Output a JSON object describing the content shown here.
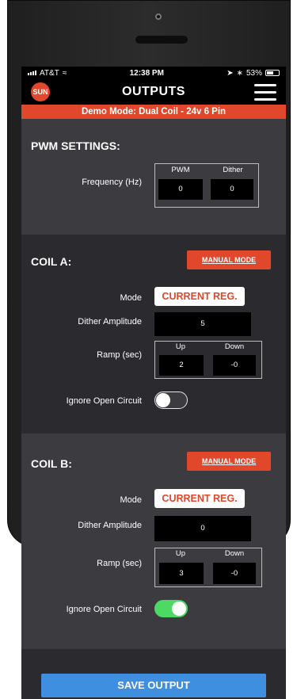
{
  "status_bar": {
    "carrier": "AT&T",
    "time": "12:38 PM",
    "battery": "53%"
  },
  "header": {
    "logo_text": "SUN",
    "title": "OUTPUTS",
    "menu_icon": "hamburger-icon"
  },
  "banner": {
    "text": "Demo Mode: Dual Coil - 24v 6 Pin"
  },
  "pwm_settings": {
    "title": "PWM SETTINGS:",
    "frequency_label": "Frequency (Hz)",
    "pwm_header": "PWM",
    "dither_header": "Dither",
    "pwm_value": "0",
    "dither_value": "0"
  },
  "coil_a": {
    "title": "COIL A:",
    "manual_mode_label": "MANUAL MODE",
    "mode_label": "Mode",
    "mode_value": "CURRENT REG.",
    "dither_amplitude_label": "Dither Amplitude",
    "dither_amplitude_value": "5",
    "ramp_label": "Ramp (sec)",
    "up_header": "Up",
    "down_header": "Down",
    "up_value": "2",
    "down_value": "-0",
    "ignore_open_label": "Ignore Open Circuit",
    "ignore_open_on": false
  },
  "coil_b": {
    "title": "COIL B:",
    "manual_mode_label": "MANUAL MODE",
    "mode_label": "Mode",
    "mode_value": "CURRENT REG.",
    "dither_amplitude_label": "Dither Amplitude",
    "dither_amplitude_value": "0",
    "ramp_label": "Ramp (sec)",
    "up_header": "Up",
    "down_header": "Down",
    "up_value": "3",
    "down_value": "-0",
    "ignore_open_label": "Ignore Open Circuit",
    "ignore_open_on": true
  },
  "save": {
    "label": "SAVE OUTPUT"
  },
  "colors": {
    "accent": "#e0472b",
    "save_button": "#3f8fe1",
    "toggle_on": "#4cd964"
  }
}
